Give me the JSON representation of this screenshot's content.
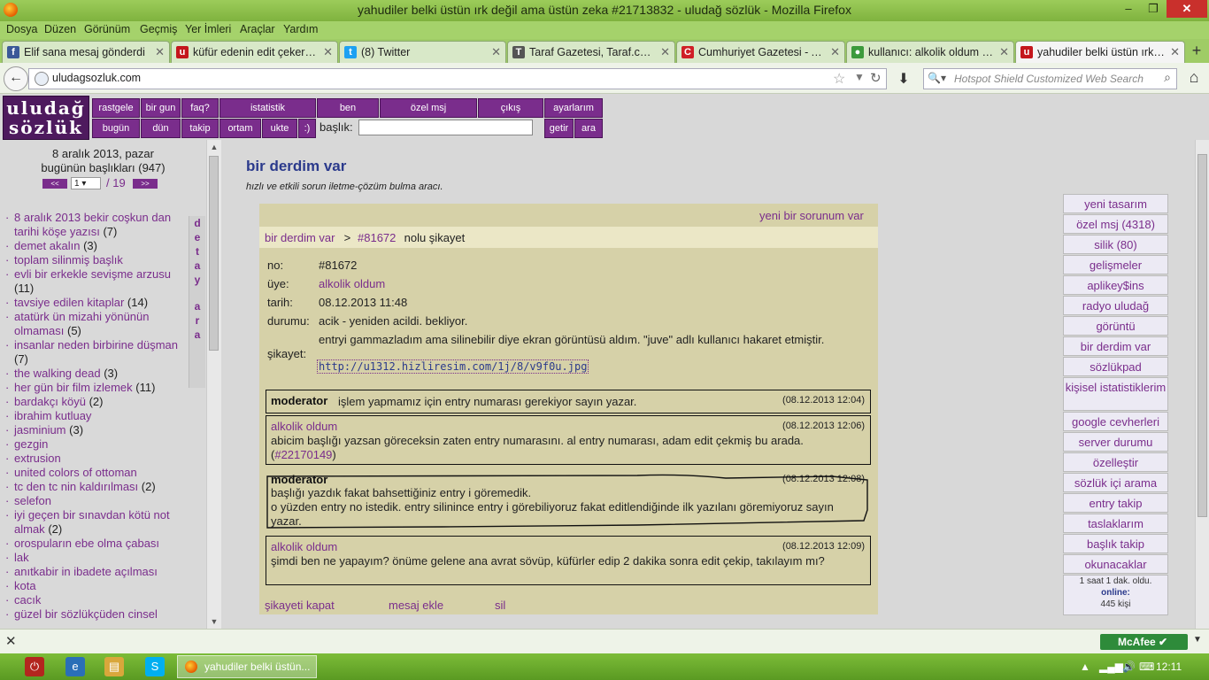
{
  "window": {
    "title": "yahudiler belki üstün ırk değil ama üstün zeka #21713832 - uludağ sözlük - Mozilla Firefox",
    "min": "–",
    "max": "❐",
    "close": "✕"
  },
  "menu": [
    "Dosya",
    "Düzen",
    "Görünüm",
    "Geçmiş",
    "Yer İmleri",
    "Araçlar",
    "Yardım"
  ],
  "tabs": [
    {
      "label": "Elif sana mesaj gönderdi",
      "icon": "f",
      "color": "#3b5998"
    },
    {
      "label": "küfür edenin edit çekerek ...",
      "icon": "u",
      "color": "#c4161c"
    },
    {
      "label": "(8) Twitter",
      "icon": "t",
      "color": "#1da1f2"
    },
    {
      "label": "Taraf Gazetesi, Taraf.com....",
      "icon": "T",
      "color": "#555555"
    },
    {
      "label": "Cumhuriyet Gazetesi - An...",
      "icon": "C",
      "color": "#d01f26"
    },
    {
      "label": "kullanıcı: alkolik oldum - e...",
      "icon": "●",
      "color": "#3c9a3c"
    },
    {
      "label": "yahudiler belki üstün ırk d...",
      "icon": "u",
      "color": "#c4161c"
    }
  ],
  "nav": {
    "url": "uludagsozluk.com",
    "search_placeholder": "Hotspot Shield Customized Web Search",
    "search_engine_label": "🔍▾"
  },
  "site": {
    "logo_line1": "uludağ",
    "logo_line2": "sözlük",
    "nav_row1": [
      "rastgele",
      "bir gun",
      "faq?",
      "istatistik",
      "ben",
      "özel msj",
      "çıkış",
      "ayarlarım"
    ],
    "nav_row2": [
      "bugün",
      "dün",
      "takip",
      "ortam",
      "ukte",
      ":)"
    ],
    "title_label": "başlık:",
    "fetch_btn": "getir",
    "search_btn": "ara"
  },
  "left": {
    "date": "8 aralık 2013, pazar",
    "today_count": "bugünün başlıkları (947)",
    "prev": "<<",
    "next": ">>",
    "page": "1",
    "page_total": "/ 19",
    "detay": [
      "d",
      "e",
      "t",
      "a",
      "y",
      "",
      "a",
      "r",
      "a"
    ],
    "topics": [
      {
        "title": "8 aralık 2013 bekir coşkun dan tarihi köşe yazısı",
        "count": "(7)"
      },
      {
        "title": "demet akalın",
        "count": "(3)"
      },
      {
        "title": "toplam silinmiş başlık",
        "count": ""
      },
      {
        "title": "evli bir erkekle sevişme arzusu",
        "count": "(11)"
      },
      {
        "title": "tavsiye edilen kitaplar",
        "count": "(14)"
      },
      {
        "title": "atatürk ün mizahi yönünün olmaması",
        "count": "(5)"
      },
      {
        "title": "insanlar neden birbirine düşman",
        "count": "(7)"
      },
      {
        "title": "the walking dead",
        "count": "(3)"
      },
      {
        "title": "her gün bir film izlemek",
        "count": "(11)"
      },
      {
        "title": "bardakçı köyü",
        "count": "(2)"
      },
      {
        "title": "ibrahim kutluay",
        "count": ""
      },
      {
        "title": "jasminium",
        "count": "(3)"
      },
      {
        "title": "gezgin",
        "count": ""
      },
      {
        "title": "extrusion",
        "count": ""
      },
      {
        "title": "united colors of ottoman",
        "count": ""
      },
      {
        "title": "tc den tc nin kaldırılması",
        "count": "(2)"
      },
      {
        "title": "selefon",
        "count": ""
      },
      {
        "title": "iyi geçen bir sınavdan kötü not almak",
        "count": "(2)"
      },
      {
        "title": "orospuların ebe olma çabası",
        "count": ""
      },
      {
        "title": "lak",
        "count": ""
      },
      {
        "title": "anıtkabir in ibadete açılması",
        "count": ""
      },
      {
        "title": "kota",
        "count": ""
      },
      {
        "title": "cacık",
        "count": ""
      },
      {
        "title": "güzel bir sözlükçüden cinsel",
        "count": ""
      }
    ]
  },
  "main": {
    "title": "bir derdim var",
    "subtitle": "hızlı ve etkili sorun iletme-çözüm bulma aracı.",
    "new_problem": "yeni bir sorunum var",
    "crumb_root": "bir derdim var",
    "crumb_sep": " > ",
    "crumb_id": "#81672",
    "crumb_suffix": " nolu şikayet",
    "details": {
      "no_label": "no:",
      "no": "#81672",
      "member_label": "üye:",
      "member": "alkolik oldum",
      "date_label": "tarih:",
      "date": "08.12.2013 11:48",
      "status_label": "durumu:",
      "status": "acik - yeniden acildi. bekliyor.",
      "complaint_label": "şikayet:",
      "complaint": "entryi gammazladım ama silinebilir diye ekran görüntüsü aldım. \"juve\" adlı kullanıcı hakaret etmiştir.",
      "image_link": "http://u1312.hizliresim.com/1j/8/v9f0u.jpg"
    },
    "messages": [
      {
        "author": "moderator",
        "time": "(08.12.2013 12:04)",
        "text": "işlem yapmamız için entry numarası gerekiyor sayın yazar.",
        "link": ""
      },
      {
        "author": "alkolik oldum",
        "time": "(08.12.2013 12:06)",
        "text": "abicim başlığı yazsan göreceksin zaten entry numarasını. al entry numarası, adam edit çekmiş bu arada. (",
        "link": "#22170149",
        "after": ")"
      },
      {
        "author": "moderator",
        "time": "(08.12.2013 12:08)",
        "text": "başlığı yazdık fakat bahsettiğiniz entry i göremedik.",
        "text2": "o yüzden entry no istedik. entry silinince entry i görebiliyoruz fakat editlendiğinde ilk yazılanı göremiyoruz sayın yazar."
      },
      {
        "author": "alkolik oldum",
        "time": "(08.12.2013 12:09)",
        "text": "şimdi ben ne yapayım? önüme gelene ana avrat sövüp, küfürler edip 2 dakika sonra edit çekip, takılayım mı?"
      }
    ],
    "actions": [
      "şikayeti kapat",
      "mesaj ekle",
      "sil"
    ]
  },
  "right": {
    "items": [
      "yeni tasarım",
      "özel msj (4318)",
      "silik (80)",
      "gelişmeler",
      "aplikey$ins",
      "radyo uludağ",
      "görüntü",
      "bir derdim var",
      "sözlükpad",
      "kişisel istatistiklerim",
      "google cevherleri",
      "server durumu",
      "özelleştir",
      "sözlük içi arama",
      "entry takip",
      "taslaklarım",
      "başlık takip",
      "okunacaklar"
    ],
    "online_time": "1 saat 1 dak. oldu.",
    "online_label": "online:",
    "online_count": "445 kişi"
  },
  "addon": {
    "close": "✕",
    "mcafee": "McAfee",
    "check": "✔"
  },
  "taskbar": {
    "firefox_label": "yahudiler belki üstün...",
    "clock": "12:11"
  }
}
